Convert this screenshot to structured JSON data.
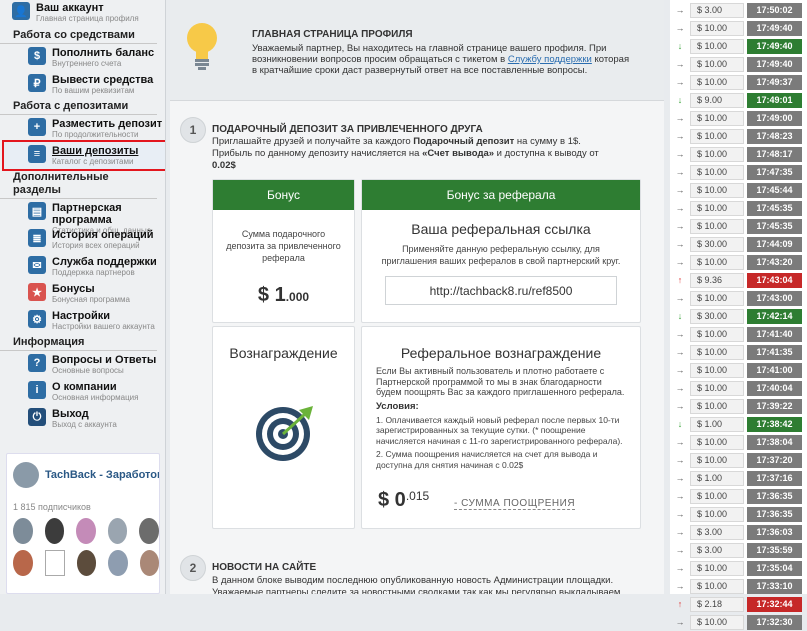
{
  "sidebar": {
    "account": {
      "title": "Ваш аккаунт",
      "sub": "Главная страница профиля"
    },
    "sections": [
      {
        "title": "Работа со средствами",
        "items": [
          {
            "title": "Пополнить баланс",
            "sub": "Внутреннего счета"
          },
          {
            "title": "Вывести средства",
            "sub": "По вашим реквизитам"
          }
        ]
      },
      {
        "title": "Работа с депозитами",
        "items": [
          {
            "title": "Разместить депозит",
            "sub": "По продолжительности времени"
          },
          {
            "title": "Ваши депозиты",
            "sub": "Каталог с депозитами",
            "badge": "2"
          }
        ]
      },
      {
        "title": "Дополнительные разделы",
        "items": [
          {
            "title": "Партнерская программа",
            "sub": "Статистика и общ. данные"
          },
          {
            "title": "История операций",
            "sub": "История всех операций"
          },
          {
            "title": "Служба поддержки",
            "sub": "Поддержка партнеров"
          },
          {
            "title": "Бонусы",
            "sub": "Бонусная программа"
          },
          {
            "title": "Настройки",
            "sub": "Настройки вашего аккаунта"
          }
        ]
      },
      {
        "title": "Информация",
        "items": [
          {
            "title": "Вопросы и Ответы",
            "sub": "Основные вопросы"
          },
          {
            "title": "О компании",
            "sub": "Основная информация"
          },
          {
            "title": "Выход",
            "sub": "Выход с аккаунта"
          }
        ]
      }
    ],
    "vk": {
      "name": "TachBack - Заработок ...",
      "subscribers": "1 815 подписчиков"
    }
  },
  "notice": {
    "title": "ГЛАВНАЯ СТРАНИЦА ПРОФИЛЯ",
    "text1": "Уважаемый партнер, Вы находитесь на главной странице вашего профиля. При возникновении вопросов просим обращаться с тикетом в ",
    "link": "Службу поддержки",
    "text2": " которая в кратчайшие сроки даст развернутый ответ на все поставленные вопросы."
  },
  "step1": {
    "num": "1",
    "title": "ПОДАРОЧНЫЙ ДЕПОЗИТ ЗА ПРИВЛЕЧЕННОГО ДРУГА",
    "text_a": "Приглашайте друзей и получайте за каждого ",
    "text_b": "Подарочный депозит",
    "text_c": " на сумму в 1$. Прибыль по данному депозиту начисляется на ",
    "text_d": "«Счет вывода»",
    "text_e": " и доступна к выводу от ",
    "text_f": "0.02$",
    "bonus_head": "Бонус",
    "bonus_desc": "Сумма подарочного депозита за привлеченного реферала",
    "bonus_amount": "$ 1",
    "bonus_cents": ".000",
    "ref_head": "Бонус за реферала",
    "ref_title": "Ваша реферальная ссылка",
    "ref_desc": "Применяйте данную реферальную ссылку, для приглашения ваших рефералов в свой партнерский круг.",
    "ref_link": "http://tachback8.ru/ref8500",
    "reward_title": "Вознаграждение",
    "refreward_title": "Реферальное вознаграждение",
    "refreward_text": "Если Вы активный пользователь и плотно работаете с Партнерской программой то мы в знак благодарности будем поощрять Вас за каждого приглашенного реферала.",
    "conditions": "Условия:",
    "cond1": "1. Оплачивается каждый новый реферал после первых 10-ти зарегистрированных за текущие сутки. (* поощрение начисляется начиная с 11-го зарегистрированного реферала).",
    "cond2": "2. Сумма поощрения начисляется на счет для вывода и доступна для снятия начиная с 0.02$",
    "reward_amount": "$ 0",
    "reward_cents": ".015",
    "reward_link": "- СУММА ПООЩРЕНИЯ"
  },
  "step2": {
    "num": "2",
    "title": "НОВОСТИ НА САЙТЕ",
    "text": "В данном блоке выводим последнюю опубликованную новость Администрации площадки. Уважаемые партнеры следите за новостными сводками так как мы регулярно выкладываем"
  },
  "ticker": [
    {
      "dir": "right",
      "amount": "$ 3.00",
      "time": "17:50:02",
      "color": "#7b7b7b"
    },
    {
      "dir": "right",
      "amount": "$ 10.00",
      "time": "17:49:40",
      "color": "#7b7b7b"
    },
    {
      "dir": "down",
      "amount": "$ 10.00",
      "time": "17:49:40",
      "color": "#2e7d32"
    },
    {
      "dir": "right",
      "amount": "$ 10.00",
      "time": "17:49:40",
      "color": "#7b7b7b"
    },
    {
      "dir": "right",
      "amount": "$ 10.00",
      "time": "17:49:37",
      "color": "#7b7b7b"
    },
    {
      "dir": "down",
      "amount": "$ 9.00",
      "time": "17:49:01",
      "color": "#2e7d32"
    },
    {
      "dir": "right",
      "amount": "$ 10.00",
      "time": "17:49:00",
      "color": "#7b7b7b"
    },
    {
      "dir": "right",
      "amount": "$ 10.00",
      "time": "17:48:23",
      "color": "#7b7b7b"
    },
    {
      "dir": "right",
      "amount": "$ 10.00",
      "time": "17:48:17",
      "color": "#7b7b7b"
    },
    {
      "dir": "right",
      "amount": "$ 10.00",
      "time": "17:47:35",
      "color": "#7b7b7b"
    },
    {
      "dir": "right",
      "amount": "$ 10.00",
      "time": "17:45:44",
      "color": "#7b7b7b"
    },
    {
      "dir": "right",
      "amount": "$ 10.00",
      "time": "17:45:35",
      "color": "#7b7b7b"
    },
    {
      "dir": "right",
      "amount": "$ 10.00",
      "time": "17:45:35",
      "color": "#7b7b7b"
    },
    {
      "dir": "right",
      "amount": "$ 30.00",
      "time": "17:44:09",
      "color": "#7b7b7b"
    },
    {
      "dir": "right",
      "amount": "$ 10.00",
      "time": "17:43:20",
      "color": "#7b7b7b"
    },
    {
      "dir": "up",
      "amount": "$ 9.36",
      "time": "17:43:04",
      "color": "#c62828"
    },
    {
      "dir": "right",
      "amount": "$ 10.00",
      "time": "17:43:00",
      "color": "#7b7b7b"
    },
    {
      "dir": "down",
      "amount": "$ 30.00",
      "time": "17:42:14",
      "color": "#2e7d32"
    },
    {
      "dir": "right",
      "amount": "$ 10.00",
      "time": "17:41:40",
      "color": "#7b7b7b"
    },
    {
      "dir": "right",
      "amount": "$ 10.00",
      "time": "17:41:35",
      "color": "#7b7b7b"
    },
    {
      "dir": "right",
      "amount": "$ 10.00",
      "time": "17:41:00",
      "color": "#7b7b7b"
    },
    {
      "dir": "right",
      "amount": "$ 10.00",
      "time": "17:40:04",
      "color": "#7b7b7b"
    },
    {
      "dir": "right",
      "amount": "$ 10.00",
      "time": "17:39:22",
      "color": "#7b7b7b"
    },
    {
      "dir": "down",
      "amount": "$ 1.00",
      "time": "17:38:42",
      "color": "#2e7d32"
    },
    {
      "dir": "right",
      "amount": "$ 10.00",
      "time": "17:38:04",
      "color": "#7b7b7b"
    },
    {
      "dir": "right",
      "amount": "$ 10.00",
      "time": "17:37:20",
      "color": "#7b7b7b"
    },
    {
      "dir": "right",
      "amount": "$ 1.00",
      "time": "17:37:16",
      "color": "#7b7b7b"
    },
    {
      "dir": "right",
      "amount": "$ 10.00",
      "time": "17:36:35",
      "color": "#7b7b7b"
    },
    {
      "dir": "right",
      "amount": "$ 10.00",
      "time": "17:36:35",
      "color": "#7b7b7b"
    },
    {
      "dir": "right",
      "amount": "$ 3.00",
      "time": "17:36:03",
      "color": "#7b7b7b"
    },
    {
      "dir": "right",
      "amount": "$ 3.00",
      "time": "17:35:59",
      "color": "#7b7b7b"
    },
    {
      "dir": "right",
      "amount": "$ 10.00",
      "time": "17:35:04",
      "color": "#7b7b7b"
    },
    {
      "dir": "right",
      "amount": "$ 10.00",
      "time": "17:33:10",
      "color": "#7b7b7b"
    },
    {
      "dir": "up",
      "amount": "$ 2.18",
      "time": "17:32:44",
      "color": "#c62828"
    },
    {
      "dir": "right",
      "amount": "$ 10.00",
      "time": "17:32:30",
      "color": "#7b7b7b"
    }
  ]
}
